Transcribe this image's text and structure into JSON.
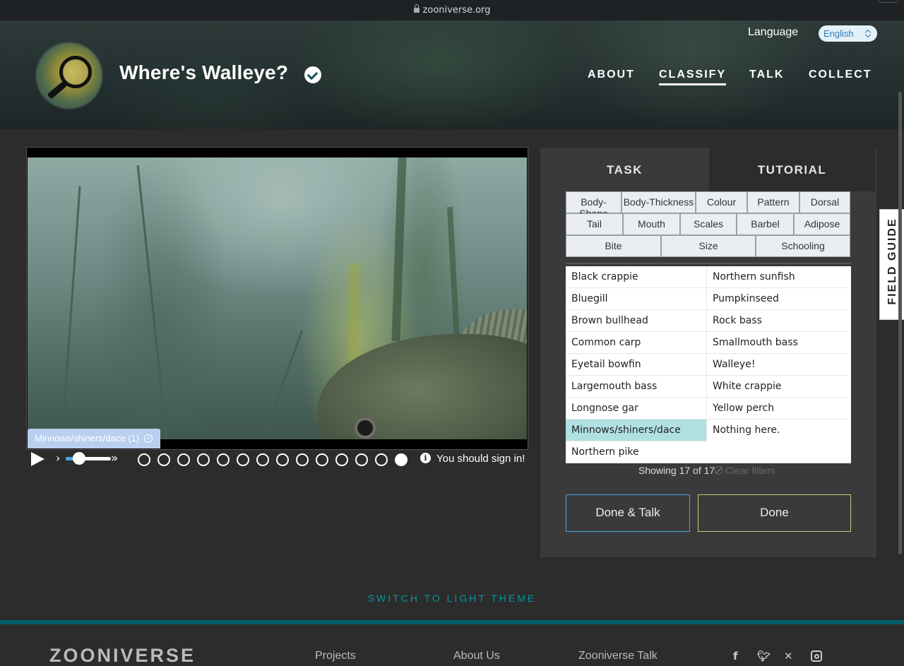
{
  "browser": {
    "url": "zooniverse.org"
  },
  "header": {
    "title": "Where's Walleye?",
    "language_label": "Language",
    "language_value": "English",
    "nav": [
      {
        "label": "ABOUT"
      },
      {
        "label": "CLASSIFY",
        "active": true
      },
      {
        "label": "TALK"
      },
      {
        "label": "COLLECT"
      }
    ]
  },
  "viewer": {
    "selected_tag": "Minnows/shiners/dace (1)",
    "tag_remove": "×",
    "info_glyph": "i",
    "sign_in_text": "You should sign in!",
    "frame_count": 14,
    "current_frame": 14,
    "play_speed_fraction": 0.3
  },
  "panel": {
    "tabs": {
      "task": "TASK",
      "tutorial": "TUTORIAL"
    },
    "filters_row1": [
      "Body-Shape",
      "Body-Thickness",
      "Colour",
      "Pattern",
      "Dorsal"
    ],
    "filters_row2": [
      "Tail",
      "Mouth",
      "Scales",
      "Barbel",
      "Adipose"
    ],
    "filters_row3": [
      "Bite",
      "Size",
      "Schooling"
    ],
    "species_left": [
      "Black crappie",
      "Bluegill",
      "Brown bullhead",
      "Common carp",
      "Eyetail bowfin",
      "Largemouth bass",
      "Longnose gar",
      "Minnows/shiners/dace",
      "Northern pike"
    ],
    "species_right": [
      "Northern sunfish",
      "Pumpkinseed",
      "Rock bass",
      "Smallmouth bass",
      "Walleye!",
      "White crappie",
      "Yellow perch",
      "Nothing here."
    ],
    "selected_species": "Minnows/shiners/dace",
    "showing": "Showing 17 of 17",
    "clear_filters": "Clear filters",
    "done_talk": "Done & Talk",
    "done": "Done"
  },
  "field_guide": "FIELD GUIDE",
  "theme_switch": "SWITCH TO LIGHT THEME",
  "footer": {
    "logo": "ZOONIVERSE",
    "links": [
      "Projects",
      "About Us",
      "Zooniverse Talk"
    ],
    "social": [
      "facebook-icon",
      "twitter-icon",
      "bluesky-icon",
      "instagram-icon"
    ]
  }
}
